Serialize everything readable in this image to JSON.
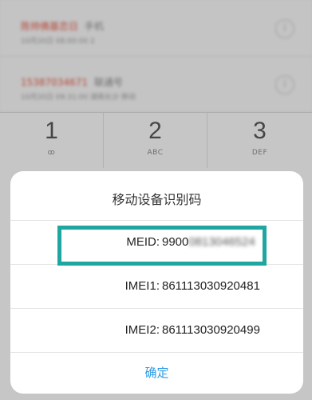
{
  "call_log": [
    {
      "name": "陈帅佛基恋日",
      "tag": "手机",
      "meta": "10月20日 08:00:00  2"
    },
    {
      "name": "15387034671",
      "tag": "联通号",
      "meta": "10月20日 09:31:00  湖南长沙 移动"
    }
  ],
  "keypad": [
    {
      "digit": "1",
      "sub": "ꝏ"
    },
    {
      "digit": "2",
      "sub": "ABC"
    },
    {
      "digit": "3",
      "sub": "DEF"
    }
  ],
  "dialog": {
    "title": "移动设备识别码",
    "rows": [
      {
        "label": "MEID:",
        "value_visible": "9900",
        "value_blurred": "0813046524"
      },
      {
        "label": "IMEI1:",
        "value": "861113030920481"
      },
      {
        "label": "IMEI2:",
        "value": "861113030920499"
      }
    ],
    "confirm": "确定"
  },
  "colors": {
    "highlight": "#1ea7a0",
    "confirm": "#2a9be6"
  }
}
